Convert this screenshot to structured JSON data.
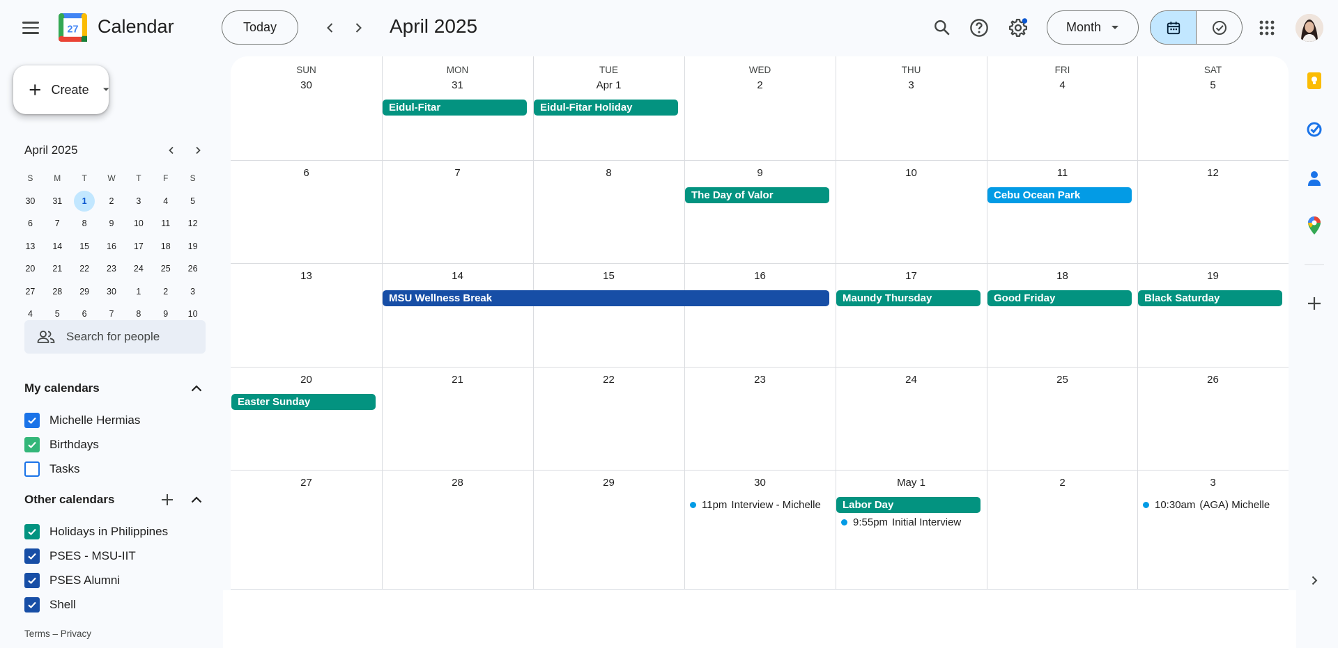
{
  "header": {
    "app_title": "Calendar",
    "logo_day": "27",
    "today_label": "Today",
    "month_title": "April 2025",
    "view_label": "Month"
  },
  "sidebar": {
    "create_label": "Create",
    "mini_title": "April 2025",
    "mini_dow": [
      "S",
      "M",
      "T",
      "W",
      "T",
      "F",
      "S"
    ],
    "mini_weeks": [
      [
        "30",
        "31",
        "1",
        "2",
        "3",
        "4",
        "5"
      ],
      [
        "6",
        "7",
        "8",
        "9",
        "10",
        "11",
        "12"
      ],
      [
        "13",
        "14",
        "15",
        "16",
        "17",
        "18",
        "19"
      ],
      [
        "20",
        "21",
        "22",
        "23",
        "24",
        "25",
        "26"
      ],
      [
        "27",
        "28",
        "29",
        "30",
        "1",
        "2",
        "3"
      ],
      [
        "4",
        "5",
        "6",
        "7",
        "8",
        "9",
        "10"
      ]
    ],
    "search_people_placeholder": "Search for people",
    "my_calendars_title": "My calendars",
    "my_calendars": [
      {
        "label": "Michelle Hermias",
        "color": "#1a73e8",
        "checked": true
      },
      {
        "label": "Birthdays",
        "color": "#33b679",
        "checked": true
      },
      {
        "label": "Tasks",
        "color": "#1a73e8",
        "checked": false
      }
    ],
    "other_calendars_title": "Other calendars",
    "other_calendars": [
      {
        "label": "Holidays in Philippines",
        "color": "#039380",
        "checked": true
      },
      {
        "label": "PSES - MSU-IIT",
        "color": "#174ea6",
        "checked": true
      },
      {
        "label": "PSES Alumni",
        "color": "#174ea6",
        "checked": true
      },
      {
        "label": "Shell",
        "color": "#174ea6",
        "checked": true
      }
    ],
    "footer": "Terms – Privacy"
  },
  "grid": {
    "dow": [
      "SUN",
      "MON",
      "TUE",
      "WED",
      "THU",
      "FRI",
      "SAT"
    ],
    "weeks": [
      [
        "30",
        "31",
        "Apr 1",
        "2",
        "3",
        "4",
        "5"
      ],
      [
        "6",
        "7",
        "8",
        "9",
        "10",
        "11",
        "12"
      ],
      [
        "13",
        "14",
        "15",
        "16",
        "17",
        "18",
        "19"
      ],
      [
        "20",
        "21",
        "22",
        "23",
        "24",
        "25",
        "26"
      ],
      [
        "27",
        "28",
        "29",
        "30",
        "May 1",
        "2",
        "3"
      ]
    ],
    "events": [
      {
        "title": "Eidul-Fitar",
        "week": 0,
        "day": 1,
        "span": 1,
        "color": "teal"
      },
      {
        "title": "Eidul-Fitar Holiday",
        "week": 0,
        "day": 2,
        "span": 1,
        "color": "teal"
      },
      {
        "title": "The Day of Valor",
        "week": 1,
        "day": 3,
        "span": 1,
        "color": "teal"
      },
      {
        "title": "Cebu Ocean Park",
        "week": 1,
        "day": 5,
        "span": 1,
        "color": "blue"
      },
      {
        "title": "MSU Wellness Break",
        "week": 2,
        "day": 1,
        "span": 3,
        "color": "navy"
      },
      {
        "title": "Maundy Thursday",
        "week": 2,
        "day": 4,
        "span": 1,
        "color": "teal"
      },
      {
        "title": "Good Friday",
        "week": 2,
        "day": 5,
        "span": 1,
        "color": "teal"
      },
      {
        "title": "Black Saturday",
        "week": 2,
        "day": 6,
        "span": 1,
        "color": "teal"
      },
      {
        "title": "Easter Sunday",
        "week": 3,
        "day": 0,
        "span": 1,
        "color": "teal"
      },
      {
        "title": "Labor Day",
        "week": 4,
        "day": 4,
        "span": 1,
        "color": "teal"
      }
    ],
    "timed_events": [
      {
        "time": "11pm",
        "title": "Interview - Michelle",
        "week": 4,
        "day": 3,
        "row": 0
      },
      {
        "time": "9:55pm",
        "title": "Initial Interview",
        "week": 4,
        "day": 4,
        "row": 1
      },
      {
        "time": "10:30am",
        "title": "(AGA) Michelle",
        "week": 4,
        "day": 6,
        "row": 0
      }
    ]
  },
  "icons": {
    "menu": "hamburger-icon",
    "search": "search-icon",
    "help": "help-icon",
    "settings": "gear-icon",
    "apps": "apps-grid-icon",
    "keep": "keep-icon",
    "tasks": "tasks-icon",
    "contacts": "contacts-icon",
    "maps": "maps-icon"
  },
  "colors": {
    "teal": "#039380",
    "blue": "#039be5",
    "navy": "#174ea6",
    "accent": "#0b57d0"
  }
}
